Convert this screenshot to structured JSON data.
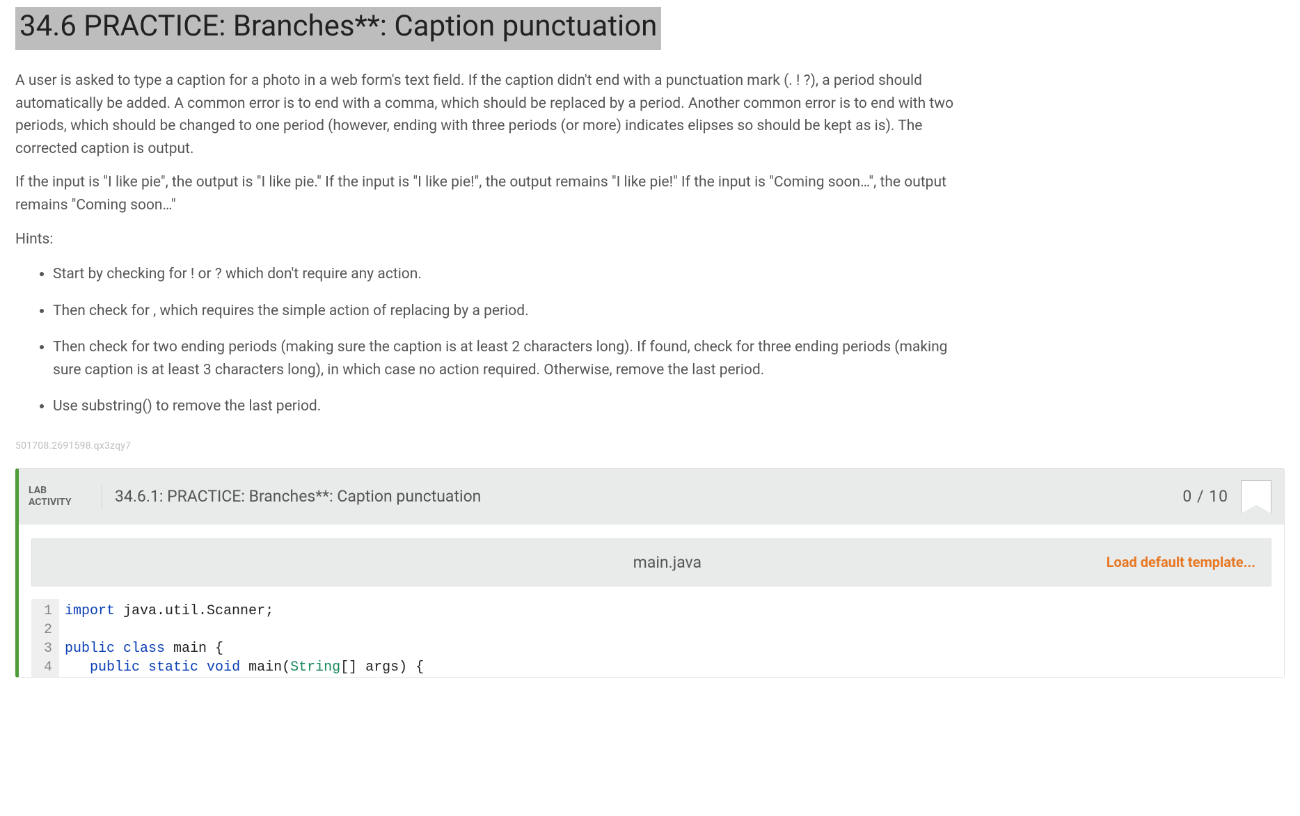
{
  "title": "34.6 PRACTICE: Branches**: Caption punctuation",
  "para1": "A user is asked to type a caption for a photo in a web form's text field. If the caption didn't end with a punctuation mark (. ! ?), a period should automatically be added. A common error is to end with a comma, which should be replaced by a period. Another common error is to end with two periods, which should be changed to one period (however, ending with three periods (or more) indicates elipses so should be kept as is). The corrected caption is output.",
  "para2": "If the input is \"I like pie\", the output is \"I like pie.\" If the input is \"I like pie!\", the output remains \"I like pie!\" If the input is \"Coming soon…\", the output remains \"Coming soon…\"",
  "hints_label": "Hints:",
  "hints": [
    "Start by checking for ! or ? which don't require any action.",
    "Then check for , which requires the simple action of replacing by a period.",
    "Then check for two ending periods (making sure the caption is at least 2 characters long). If found, check for three ending periods (making sure caption is at least 3 characters long), in which case no action required. Otherwise, remove the last period.",
    "Use substring() to remove the last period."
  ],
  "watermark": "501708.2691598.qx3zqy7",
  "lab": {
    "tag_line1": "LAB",
    "tag_line2": "ACTIVITY",
    "title": "34.6.1: PRACTICE: Branches**: Caption punctuation",
    "score": "0 / 10",
    "filename": "main.java",
    "load_template": "Load default template...",
    "code_lines": [
      {
        "n": "1",
        "tokens": [
          {
            "t": "import ",
            "c": "kw"
          },
          {
            "t": "java.util.Scanner;",
            "c": "cls"
          }
        ]
      },
      {
        "n": "2",
        "tokens": []
      },
      {
        "n": "3",
        "tokens": [
          {
            "t": "public class ",
            "c": "kw"
          },
          {
            "t": "main {",
            "c": "cls"
          }
        ]
      },
      {
        "n": "4",
        "tokens": [
          {
            "t": "   ",
            "c": ""
          },
          {
            "t": "public static void ",
            "c": "kw"
          },
          {
            "t": "main(",
            "c": "cls"
          },
          {
            "t": "String",
            "c": "type"
          },
          {
            "t": "[] args) {",
            "c": "cls"
          }
        ]
      }
    ]
  }
}
